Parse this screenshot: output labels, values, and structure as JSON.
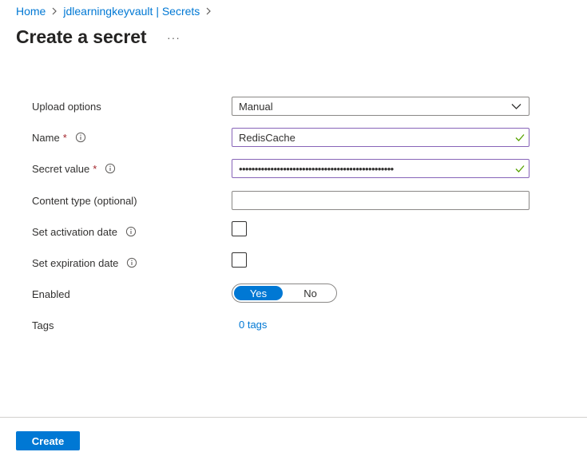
{
  "breadcrumb": {
    "items": [
      "Home",
      "jdlearningkeyvault | Secrets"
    ]
  },
  "header": {
    "title": "Create a secret",
    "more_label": "···"
  },
  "form": {
    "upload_options": {
      "label": "Upload options",
      "value": "Manual"
    },
    "name": {
      "label": "Name",
      "required_mark": "*",
      "value": "RedisCache"
    },
    "secret_value": {
      "label": "Secret value",
      "required_mark": "*",
      "value": "•••••••••••••••••••••••••••••••••••••••••••••••••"
    },
    "content_type": {
      "label": "Content type (optional)",
      "value": ""
    },
    "activation": {
      "label": "Set activation date",
      "checked": false
    },
    "expiration": {
      "label": "Set expiration date",
      "checked": false
    },
    "enabled": {
      "label": "Enabled",
      "yes_label": "Yes",
      "no_label": "No",
      "selected": "Yes"
    },
    "tags": {
      "label": "Tags",
      "link_label": "0 tags"
    }
  },
  "footer": {
    "create_label": "Create"
  },
  "colors": {
    "accent": "#0078d4",
    "valid_border": "#8764b8",
    "valid_check": "#57a300",
    "required": "#a4262c"
  }
}
